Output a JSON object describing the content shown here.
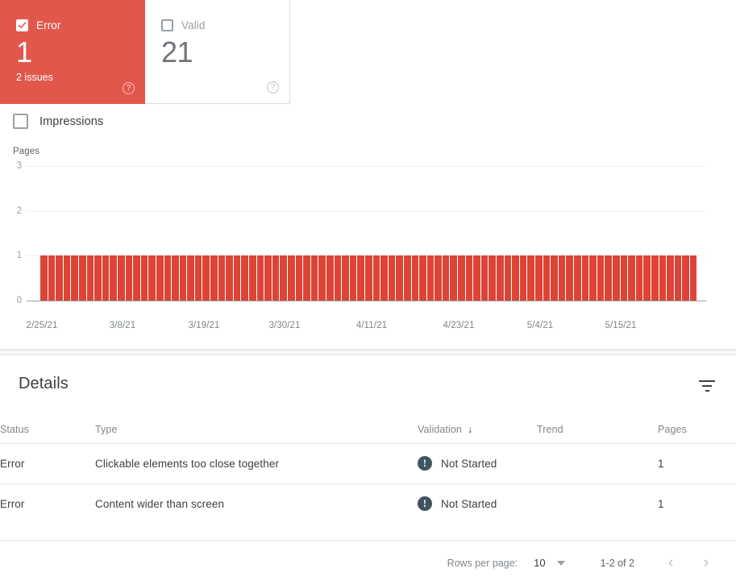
{
  "summary_tiles": [
    {
      "id": "error",
      "label": "Error",
      "count": "1",
      "sub": "2 issues",
      "checked": true,
      "help": "?",
      "bg": "#e2574c"
    },
    {
      "id": "valid",
      "label": "Valid",
      "count": "21",
      "sub": "",
      "checked": false,
      "help": "?",
      "bg": "#ffffff"
    }
  ],
  "impressions": {
    "label": "Impressions",
    "checked": false
  },
  "chart_data": {
    "type": "bar",
    "title": "",
    "ylabel": "Pages",
    "xlabel": "",
    "ylim": [
      0,
      3
    ],
    "yticks": [
      "3",
      "2",
      "1",
      "0"
    ],
    "grid": true,
    "legend": "none",
    "series_color": "#dc4437",
    "xtick_labels": [
      "2/25/21",
      "3/8/21",
      "3/19/21",
      "3/30/21",
      "4/11/21",
      "4/23/21",
      "5/4/21",
      "5/15/21"
    ],
    "xtick_positions": [
      52,
      152,
      253,
      353,
      461,
      569,
      670,
      770
    ],
    "categories": [
      "2/25/21",
      "2/26/21",
      "2/27/21",
      "2/28/21",
      "3/1/21",
      "3/2/21",
      "3/3/21",
      "3/4/21",
      "3/5/21",
      "3/6/21",
      "3/7/21",
      "3/8/21",
      "3/9/21",
      "3/10/21",
      "3/11/21",
      "3/12/21",
      "3/13/21",
      "3/14/21",
      "3/15/21",
      "3/16/21",
      "3/17/21",
      "3/18/21",
      "3/19/21",
      "3/20/21",
      "3/21/21",
      "3/22/21",
      "3/23/21",
      "3/24/21",
      "3/25/21",
      "3/26/21",
      "3/27/21",
      "3/28/21",
      "3/29/21",
      "3/30/21",
      "3/31/21",
      "4/1/21",
      "4/2/21",
      "4/3/21",
      "4/4/21",
      "4/5/21",
      "4/6/21",
      "4/7/21",
      "4/8/21",
      "4/9/21",
      "4/10/21",
      "4/11/21",
      "4/12/21",
      "4/13/21",
      "4/14/21",
      "4/15/21",
      "4/16/21",
      "4/17/21",
      "4/18/21",
      "4/19/21",
      "4/20/21",
      "4/21/21",
      "4/22/21",
      "4/23/21",
      "4/24/21",
      "4/25/21",
      "4/26/21",
      "4/27/21",
      "4/28/21",
      "4/29/21",
      "4/30/21",
      "5/1/21",
      "5/2/21",
      "5/3/21",
      "5/4/21",
      "5/5/21",
      "5/6/21",
      "5/7/21",
      "5/8/21",
      "5/9/21",
      "5/10/21",
      "5/11/21",
      "5/12/21",
      "5/13/21",
      "5/14/21",
      "5/15/21",
      "5/16/21",
      "5/17/21",
      "5/18/21",
      "5/19/21",
      "5/20/21"
    ],
    "values": [
      1,
      1,
      1,
      1,
      1,
      1,
      1,
      1,
      1,
      1,
      1,
      1,
      1,
      1,
      1,
      1,
      1,
      1,
      1,
      1,
      1,
      1,
      1,
      1,
      1,
      1,
      1,
      1,
      1,
      1,
      1,
      1,
      1,
      1,
      1,
      1,
      1,
      1,
      1,
      1,
      1,
      1,
      1,
      1,
      1,
      1,
      1,
      1,
      1,
      1,
      1,
      1,
      1,
      1,
      1,
      1,
      1,
      1,
      1,
      1,
      1,
      1,
      1,
      1,
      1,
      1,
      1,
      1,
      1,
      1,
      1,
      1,
      1,
      1,
      1,
      1,
      1,
      1,
      1,
      1,
      1,
      1,
      1,
      1,
      1
    ]
  },
  "details": {
    "title": "Details",
    "filter_icon": "filter-icon",
    "columns": [
      "Status",
      "Type",
      "Validation",
      "Trend",
      "Pages"
    ],
    "sort_column": "Validation",
    "sort_arrow": "↓",
    "rows": [
      {
        "status": "Error",
        "type": "Clickable elements too close together",
        "validation": "Not Started",
        "validation_icon": "alert-icon",
        "trend": "flat",
        "pages": "1"
      },
      {
        "status": "Error",
        "type": "Content wider than screen",
        "validation": "Not Started",
        "validation_icon": "alert-icon",
        "trend": "flat",
        "pages": "1"
      }
    ]
  },
  "pagination": {
    "rows_per_page_label": "Rows per page:",
    "rows_per_page_value": "10",
    "range_label": "1-2 of 2",
    "prev_icon": "‹",
    "next_icon": "›"
  }
}
